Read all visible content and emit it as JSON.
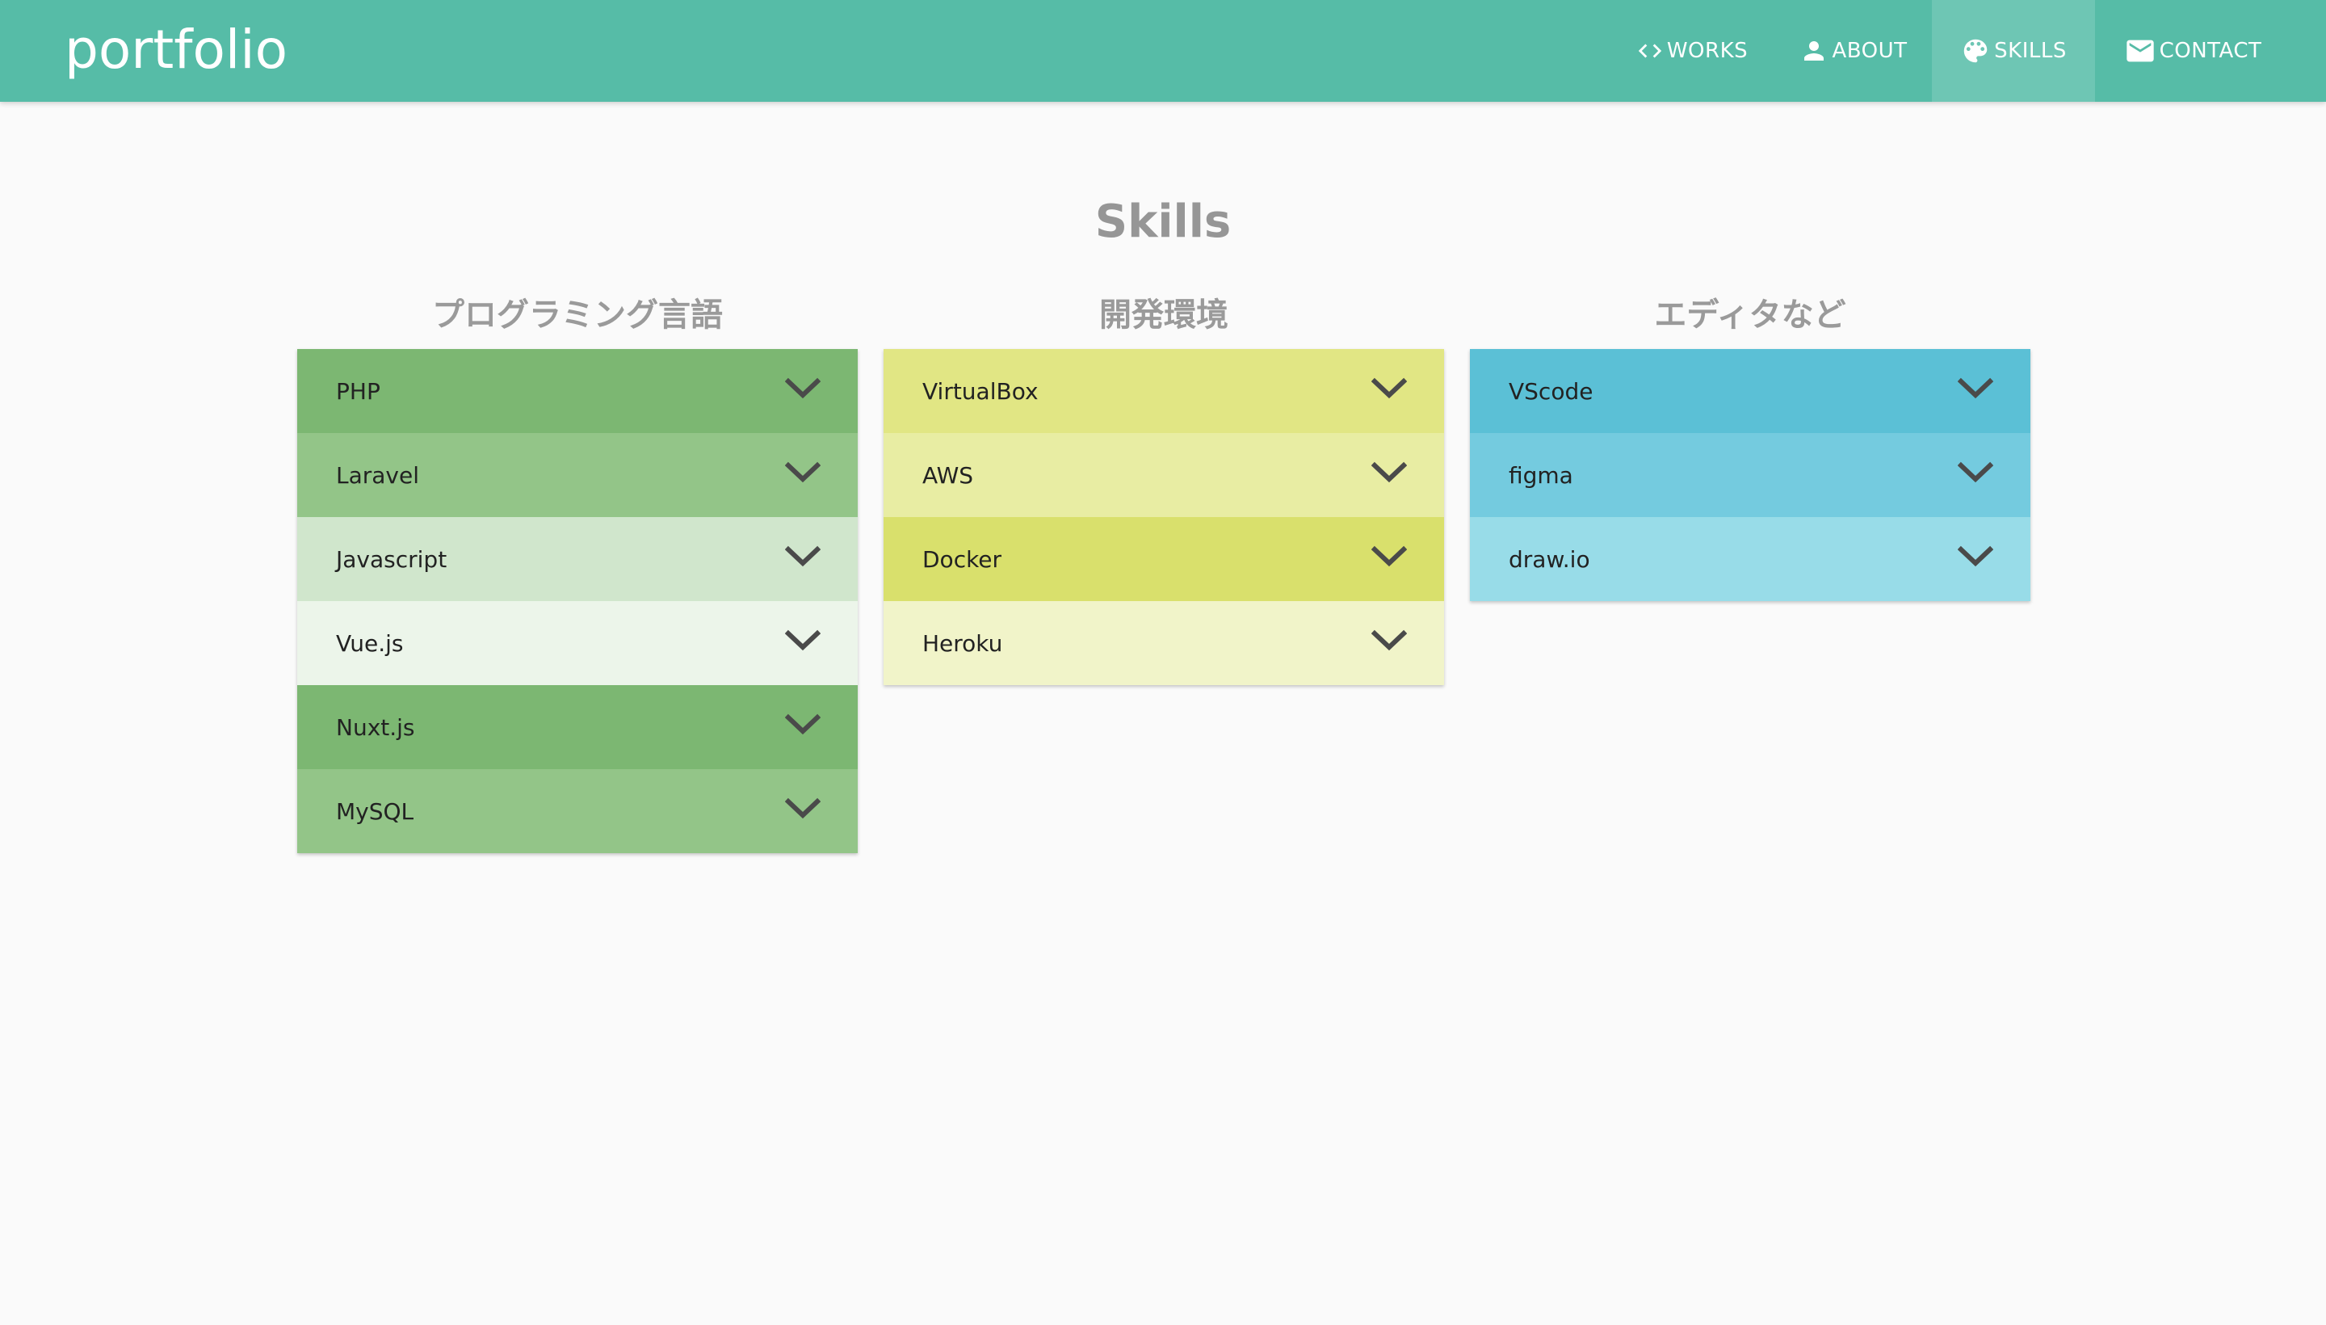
{
  "header": {
    "brand": "portfolio",
    "nav": [
      {
        "label": "WORKS",
        "icon": "code-icon"
      },
      {
        "label": "ABOUT",
        "icon": "person-icon"
      },
      {
        "label": "SKILLS",
        "icon": "palette-icon",
        "active": true
      },
      {
        "label": "CONTACT",
        "icon": "mail-icon"
      }
    ]
  },
  "main": {
    "title": "Skills",
    "columns": [
      {
        "title": "プログラミング言語",
        "items": [
          {
            "label": "PHP",
            "color": "#7cb772"
          },
          {
            "label": "Laravel",
            "color": "#93c588"
          },
          {
            "label": "Javascript",
            "color": "#d0e6cc"
          },
          {
            "label": "Vue.js",
            "color": "#ecf5ea"
          },
          {
            "label": "Nuxt.js",
            "color": "#7cb772"
          },
          {
            "label": "MySQL",
            "color": "#93c588"
          }
        ]
      },
      {
        "title": "開発環境",
        "items": [
          {
            "label": "VirtualBox",
            "color": "#e1e684"
          },
          {
            "label": "AWS",
            "color": "#e8eda3"
          },
          {
            "label": "Docker",
            "color": "#d9e06c"
          },
          {
            "label": "Heroku",
            "color": "#f1f4c9"
          }
        ]
      },
      {
        "title": "エディタなど",
        "items": [
          {
            "label": "VScode",
            "color": "#5bc0d6"
          },
          {
            "label": "figma",
            "color": "#74cbdf"
          },
          {
            "label": "draw.io",
            "color": "#98dce8"
          }
        ]
      }
    ]
  },
  "colors": {
    "header_bg": "#56bca7",
    "header_active_bg": "#6ec6b4",
    "page_bg": "#fafafa",
    "title_text": "#969696",
    "chevron": "#4a4a4a"
  }
}
